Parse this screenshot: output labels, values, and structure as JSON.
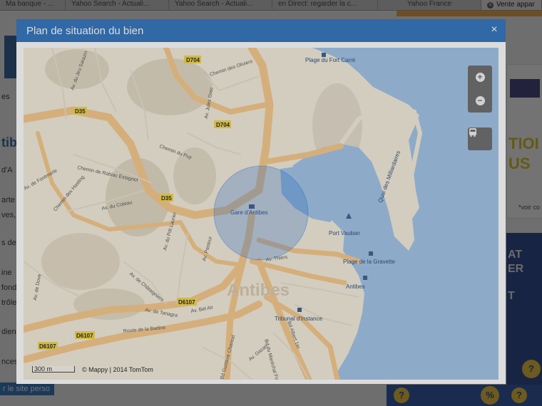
{
  "browser": {
    "tabs": [
      {
        "label": "Ma banque - ..."
      },
      {
        "label": "Yahoo Search - Actuali..."
      },
      {
        "label": "Yahoo Search - Actuali..."
      },
      {
        "label": "en Direct: regarder la c..."
      },
      {
        "label": "Yahoo France"
      },
      {
        "label": "Vente appar"
      }
    ],
    "active_tab_close": "✕"
  },
  "background_page": {
    "side_texts": [
      "es",
      "tibe",
      "d'A",
      "arte",
      "ves,",
      "s de",
      "ine",
      "fond",
      "trôle",
      "dien",
      "nces"
    ],
    "perso_button": "r le site perso",
    "ad_top_words": [
      "TIOI",
      "US"
    ],
    "ad_top_note": "*voir co",
    "ad_bottom_words": [
      "AT",
      "ER",
      "T"
    ],
    "bubble_glyphs": [
      "?",
      "%",
      "?",
      "?"
    ]
  },
  "modal": {
    "title": "Plan de situation du bien",
    "close_label": "×",
    "map": {
      "zoom_in": "+",
      "zoom_out": "−",
      "transport_icon": "bus-icon",
      "scale_label": "300 m",
      "copyright": "© Mappy | 2014 TomTom",
      "city_label": "Antibes",
      "road_badges": [
        "D704",
        "D704",
        "D35",
        "D35",
        "D6107",
        "D6107",
        "D6107"
      ],
      "places": [
        "Plage du Fort Carré",
        "Gare d'Antibes",
        "Port Vauban",
        "Plage de la Gravette",
        "Antibes",
        "Tribunal d'Instance",
        "Quai des Milliardaires"
      ],
      "streets": [
        "Chemin des Oliviers",
        "Av. Jules Grec",
        "Av. du Jeu Sarazin",
        "Chemin du Puy",
        "Chemin de Rabiac Estagnol",
        "Av. de Fontmerle",
        "Av. du Coteau",
        "Av. du Pdt Laurier",
        "Av. Pasteur",
        "Av. Thiers",
        "Av. de Châtaigniers",
        "Av. de Tanagra",
        "Av. Bel Air",
        "Route de la Badine",
        "Bd Gustave Chancel",
        "Bd Albert 1er",
        "Bd du Maréchal Foch",
        "Av. Gazan",
        "Av. de Dove",
        "Chemin des Hasting"
      ]
    }
  }
}
